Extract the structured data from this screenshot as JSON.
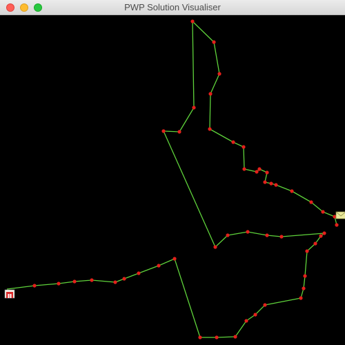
{
  "window": {
    "title": "PWP Solution Visualiser"
  },
  "colors": {
    "background": "#000000",
    "route": "#5fd33b",
    "node": "#e3201b"
  },
  "icons": {
    "depot": "warehouse-icon",
    "customer": "envelope-icon"
  }
}
